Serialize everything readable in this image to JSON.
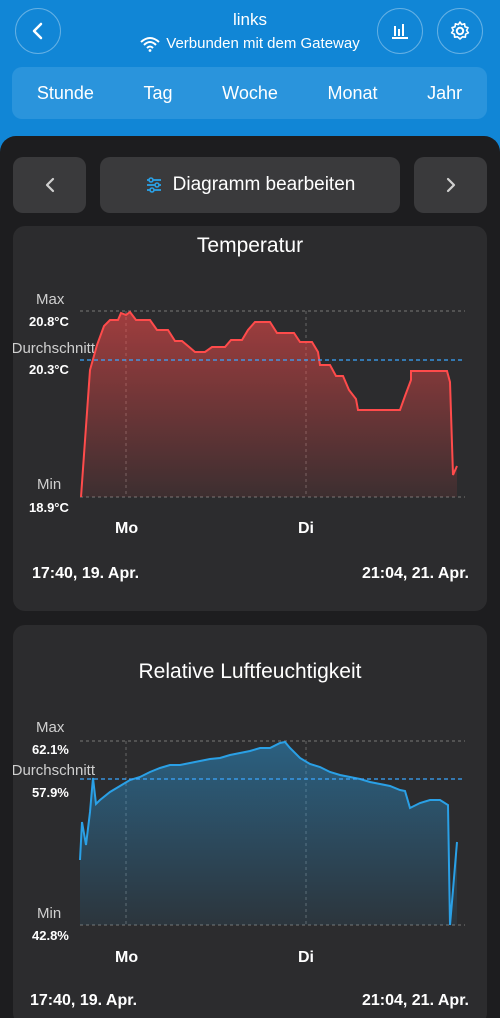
{
  "header": {
    "title": "links",
    "status": "Verbunden mit dem Gateway"
  },
  "tabs": [
    "Stunde",
    "Tag",
    "Woche",
    "Monat",
    "Jahr"
  ],
  "toolbar": {
    "edit_label": "Diagramm bearbeiten"
  },
  "charts": [
    {
      "title": "Temperatur",
      "max_label": "Max",
      "max_value": "20.8°C",
      "avg_label": "Durchschnitt",
      "avg_value": "20.3°C",
      "min_label": "Min",
      "min_value": "18.9°C",
      "day_labels": [
        "Mo",
        "Di"
      ],
      "start": "17:40,  19. Apr.",
      "end": "21:04,  21. Apr."
    },
    {
      "title": "Relative Luftfeuchtigkeit",
      "max_label": "Max",
      "max_value": "62.1%",
      "avg_label": "Durchschnitt",
      "avg_value": "57.9%",
      "min_label": "Min",
      "min_value": "42.8%",
      "day_labels": [
        "Mo",
        "Di"
      ],
      "start": "17:40,  19. Apr.",
      "end": "21:04,  21. Apr."
    }
  ],
  "colors": {
    "temperature": "#ff4b4b",
    "humidity": "#2aa0e6",
    "average": "#3aa6ff",
    "accent": "#1186d6"
  }
}
